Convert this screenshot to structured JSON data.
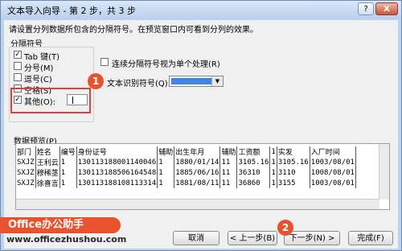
{
  "window": {
    "title": "文本导入向导 - 第 2 步，共 3 步",
    "help_label": "?",
    "close_label": "X"
  },
  "description": "请设置分列数据所包含的分隔符号。在预览窗口内可看到分列的效果。",
  "delimiters": {
    "group_title": "分隔符号",
    "tab": {
      "label": "Tab 键(T)",
      "checked": true
    },
    "semicolon": {
      "label": "分号(M)",
      "checked": false
    },
    "comma": {
      "label": "逗号(C)",
      "checked": false
    },
    "space": {
      "label": "空格(S)",
      "checked": false
    },
    "other": {
      "label": "其他(O):",
      "checked": true,
      "value": ""
    }
  },
  "consecutive": {
    "label": "连续分隔符号视为单个处理(R)",
    "checked": false
  },
  "text_qualifier": {
    "label": "文本识别符号(Q):",
    "value": ""
  },
  "preview": {
    "title": "数据预览(P)",
    "rows": [
      [
        "部门",
        "姓名",
        "编号",
        "身份证号",
        "辅助",
        "出生年月",
        "辅助",
        "工资额",
        "1",
        "实发",
        "入厂时间"
      ],
      [
        "SXJZ",
        "王利云",
        "1",
        "130113188001140046",
        "1",
        "1880/01/14",
        "11",
        "3105.16",
        "1",
        "3105.16",
        "1003/08/01"
      ],
      [
        "SXJZ",
        "穆稀茎",
        "1",
        "130113188506164548",
        "1",
        "1885/06/16",
        "11",
        "36310",
        "1",
        "3110",
        "1008/08/01"
      ],
      [
        "SXJZ",
        "徐喜言",
        "1",
        "130113188108113314",
        "1",
        "1881/08/11",
        "11",
        "36860",
        "1",
        "3155",
        "1003/08/01"
      ]
    ]
  },
  "badges": {
    "one": "1",
    "two": "2"
  },
  "buttons": {
    "cancel": "取消",
    "back": "< 上一步(B)",
    "next": "下一步(N) >",
    "finish": "完成(F)"
  },
  "watermark": {
    "logo_text": "Office办公助手",
    "url": "www.officezhushou.com"
  },
  "colors": {
    "accent": "#e8532d",
    "selection": "#3d86e6"
  }
}
